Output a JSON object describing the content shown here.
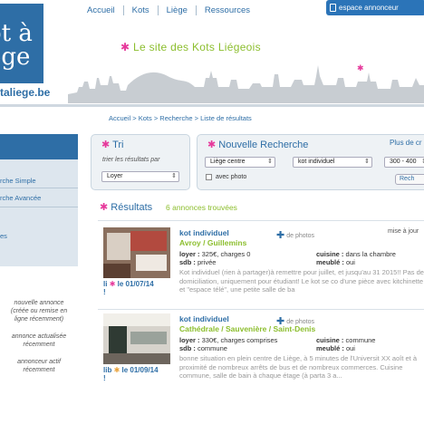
{
  "header": {
    "logo_text": "ot à\nège",
    "logo_url": "taliege.be",
    "nav": [
      "Accueil",
      "Kots",
      "Liège",
      "Ressources"
    ],
    "espace_label": "espace annonceur",
    "tagline": "Le site des Kots Liégeois",
    "accent_blue": "#2e6ea6",
    "accent_green": "#8cbe2e",
    "accent_pink": "#e6399b"
  },
  "breadcrumb": "Accueil > Kots > Recherche > Liste de résultats",
  "sidebar": {
    "items": [
      "rche Simple",
      "rche Avancée",
      "es"
    ],
    "legend": [
      "nouvelle annonce\n(créée ou remise en\nligne récemment)",
      "annonce actualisée\nrécemment",
      "annonceur actif\nrécemment"
    ]
  },
  "tri": {
    "title": "Tri",
    "label": "trier les résultats par",
    "selected": "Loyer"
  },
  "recherche": {
    "title": "Nouvelle Recherche",
    "plus_link": "Plus de cr",
    "area": "Liège centre",
    "type": "kot individuel",
    "price": "300 - 400",
    "photo_label": "avec photo",
    "search_btn": "Rech"
  },
  "results": {
    "title": "Résultats",
    "count": "6 annonces trouvées",
    "listings": [
      {
        "title": "kot individuel",
        "address": "Avroy / Guillemins",
        "photos_label": "de photos",
        "mise": "mise à jour",
        "loyer_label": "loyer :",
        "loyer": "325€, charges 0",
        "sdb_label": "sdb :",
        "sdb": "privée",
        "cuisine_label": "cuisine :",
        "cuisine": "dans la chambre",
        "meuble_label": "meublé :",
        "meuble": "oui",
        "date_prefix": "li",
        "date": "le 01/07/14",
        "date_suffix": "!",
        "description": "Kot individuel (rien à partager)à remettre pour juillet, et jusqu'au 31 2015!! Pas de domiciliation, uniquement pour étudiant! Le kot se co d'une pièce avec kitchinette et \"espace télé\", une petite salle de ba"
      },
      {
        "title": "kot individuel",
        "address": "Cathédrale / Sauvenière / Saint-Denis",
        "photos_label": "de photos",
        "mise": "",
        "loyer_label": "loyer :",
        "loyer": "330€, charges comprises",
        "sdb_label": "sdb :",
        "sdb": "commune",
        "cuisine_label": "cuisine :",
        "cuisine": "commune",
        "meuble_label": "meublé :",
        "meuble": "oui",
        "date_prefix": "lib",
        "date": "le 01/09/14",
        "date_suffix": "!",
        "description": "bonne situation en plein centre de Liège, à 5 minutes de l'Universit XX aoît et à proximité de nombreux arrêts de bus et de nombreux commerces. Cuisine commune, salle de bain à chaque étage (à parta 3 a..."
      }
    ]
  }
}
